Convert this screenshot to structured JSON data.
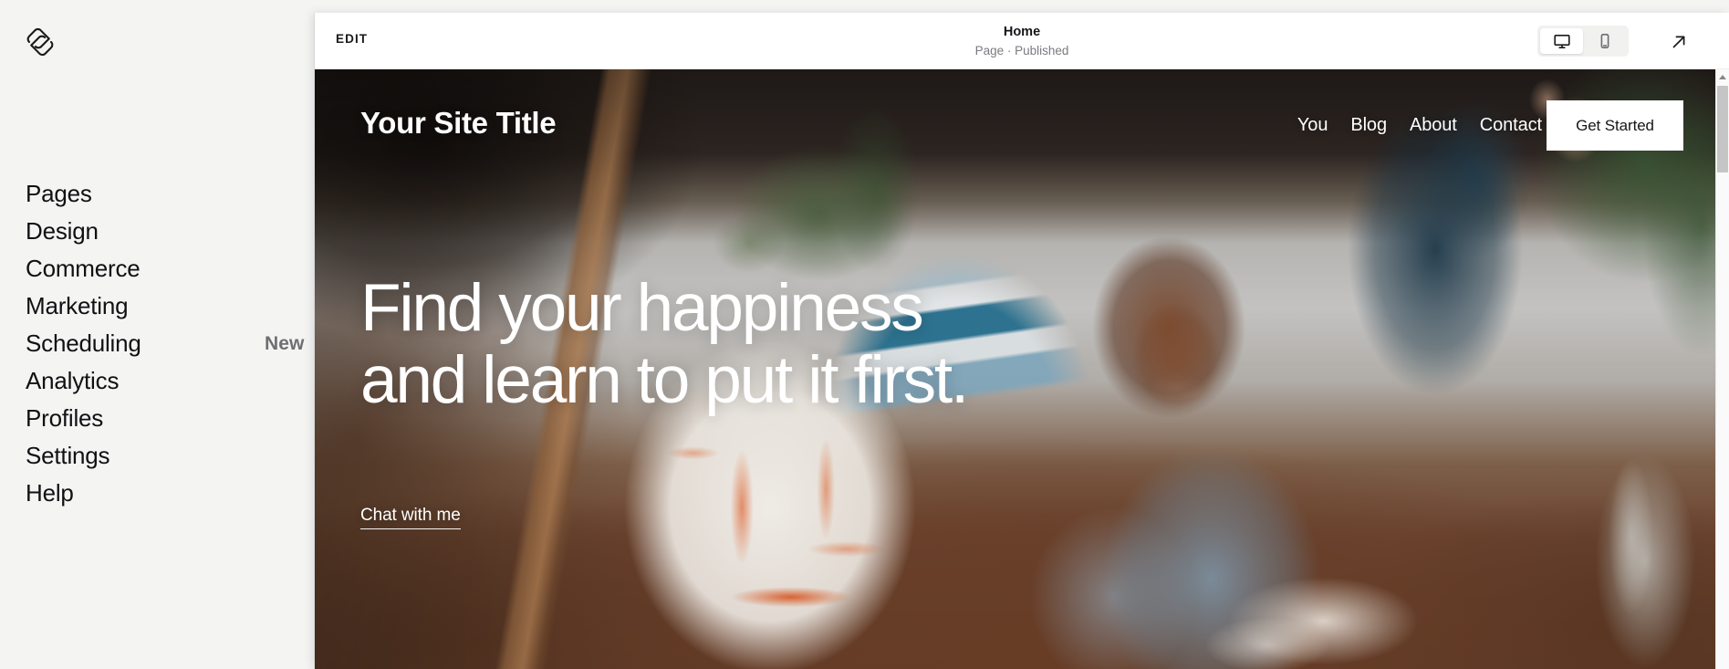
{
  "sidebar": {
    "logo_name": "squarespace-logo",
    "items": [
      {
        "label": "Pages",
        "badge": ""
      },
      {
        "label": "Design",
        "badge": ""
      },
      {
        "label": "Commerce",
        "badge": ""
      },
      {
        "label": "Marketing",
        "badge": ""
      },
      {
        "label": "Scheduling",
        "badge": "New"
      },
      {
        "label": "Analytics",
        "badge": ""
      },
      {
        "label": "Profiles",
        "badge": ""
      },
      {
        "label": "Settings",
        "badge": ""
      },
      {
        "label": "Help",
        "badge": ""
      }
    ]
  },
  "toolbar": {
    "edit_label": "EDIT",
    "page_title": "Home",
    "page_status": "Page · Published",
    "device_desktop_label": "Desktop",
    "device_mobile_label": "Mobile",
    "active_device": "Desktop",
    "open_external_label": "Open in new window"
  },
  "site": {
    "title": "Your Site Title",
    "nav": [
      "You",
      "Blog",
      "About",
      "Contact"
    ],
    "cta_button": "Get Started",
    "headline_line1": "Find your happiness",
    "headline_line2": "and learn to put it first.",
    "link_text": "Chat with me"
  },
  "colors": {
    "sidebar_bg": "#f4f4f3",
    "panel_bg": "#ffffff",
    "text_primary": "#111114",
    "text_muted": "#7b7b80",
    "badge_text": "#6e6e73",
    "toggle_bg": "#f1f1f0",
    "scrollbar_thumb": "#c5c5c5"
  }
}
